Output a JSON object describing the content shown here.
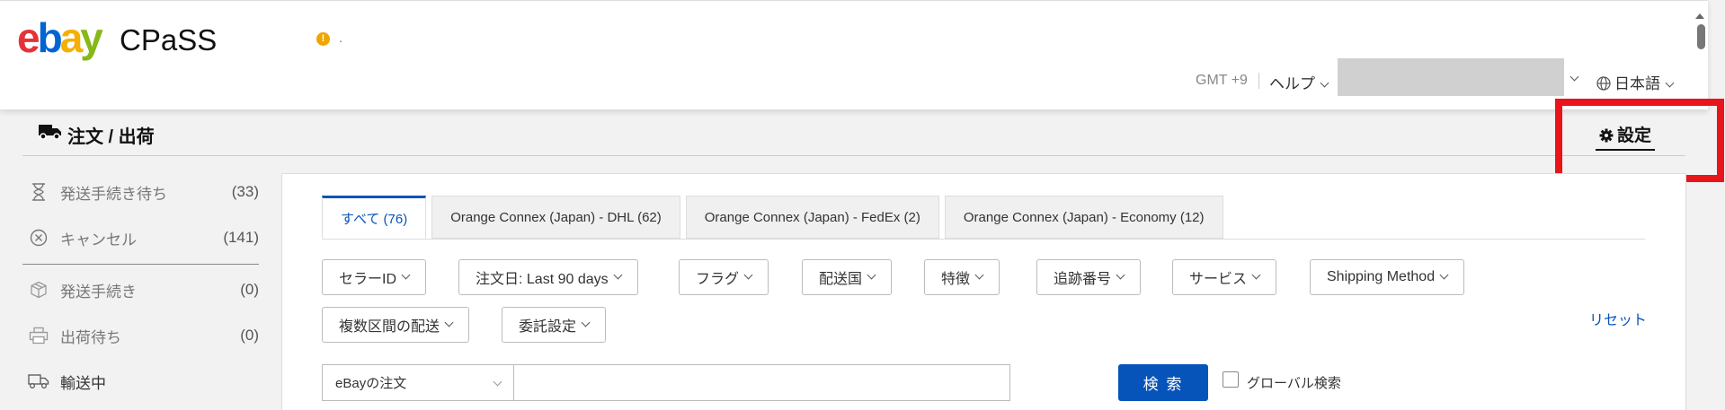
{
  "header": {
    "logo": {
      "e": "e",
      "b": "b",
      "a": "a",
      "y": "y"
    },
    "app_name": "CPaSS",
    "warning_text": ".",
    "timezone": "GMT +9",
    "help": "ヘルプ",
    "language": "日本語"
  },
  "page": {
    "title": "注文 / 出荷",
    "settings": "設定"
  },
  "sidebar": {
    "items": [
      {
        "label": "発送手続き待ち",
        "count": "(33)",
        "icon": "hourglass-icon"
      },
      {
        "label": "キャンセル",
        "count": "(141)",
        "icon": "cancel-circle-icon"
      },
      {
        "label": "発送手続き",
        "count": "(0)",
        "icon": "package-icon"
      },
      {
        "label": "出荷待ち",
        "count": "(0)",
        "icon": "printer-icon"
      },
      {
        "label": "輸送中",
        "count": "",
        "icon": "truck-icon"
      }
    ]
  },
  "tabs": [
    {
      "label": "すべて (76)",
      "active": true
    },
    {
      "label": "Orange Connex (Japan) - DHL (62)",
      "active": false
    },
    {
      "label": "Orange Connex (Japan) - FedEx (2)",
      "active": false
    },
    {
      "label": "Orange Connex (Japan) - Economy (12)",
      "active": false
    }
  ],
  "filters": {
    "seller_id": "セラーID",
    "order_date": "注文日: Last 90 days",
    "flag": "フラグ",
    "ship_country": "配送国",
    "features": "特徴",
    "tracking": "追跡番号",
    "service": "サービス",
    "shipping_method": "Shipping Method",
    "multi_leg": "複数区間の配送",
    "consign": "委託設定",
    "reset": "リセット"
  },
  "search": {
    "scope": "eBayの注文",
    "value": "",
    "button": "検 索",
    "global_label": "グローバル検索",
    "global_checked": false
  },
  "colors": {
    "accent": "#0654ba",
    "highlight_box": "#e8151b",
    "warning": "#f0a500"
  }
}
